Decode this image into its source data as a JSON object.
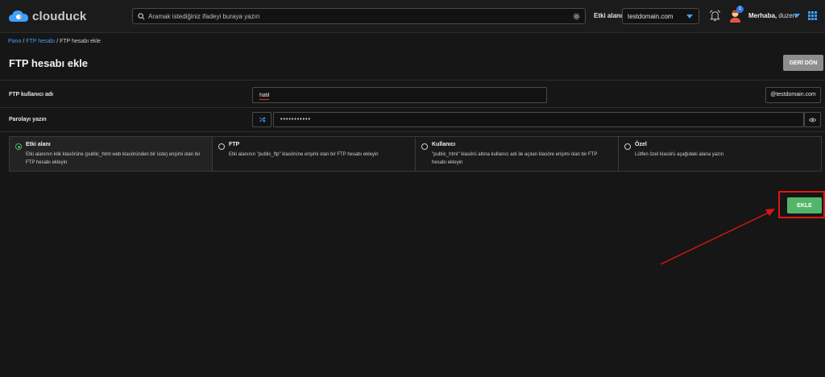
{
  "brand": {
    "name": "clouduck"
  },
  "search": {
    "placeholder": "Aramak istediğiniz ifadeyi buraya yazın"
  },
  "header": {
    "domain_label": "Etki alanı",
    "domain_value": "testdomain.com",
    "notification_count": "1",
    "greeting_prefix": "Merhaba,",
    "username": "duzen"
  },
  "breadcrumb": {
    "items": [
      "Pano",
      "FTP hesabı",
      "FTP hesabı ekle"
    ],
    "separator": " / "
  },
  "page": {
    "title": "FTP hesabı ekle",
    "back_label": "GERİ DÖN"
  },
  "form": {
    "username_label": "FTP kullanıcı adı",
    "username_value": "halil",
    "domain_suffix": "@testdomain.com",
    "password_label": "Parolayı yazın",
    "password_value": "•••••••••••"
  },
  "options": [
    {
      "title": "Etki alanı",
      "desc": "Etki alanının kök klasörüne (public_html web klasöründen bir üste) erişimi olan bir FTP hesabı ekleyin",
      "selected": true
    },
    {
      "title": "FTP",
      "desc": "Etki alanının \"public_ftp\" klasörüne erişimi olan bir FTP hesabı ekleyin",
      "selected": false
    },
    {
      "title": "Kullanıcı",
      "desc": "\"public_html\" klasörü altına kullanıcı adı ile açılan klasöre erişimi olan bir FTP hesabı ekleyin",
      "selected": false
    },
    {
      "title": "Özel",
      "desc": "Lütfen özel klasörü aşağıdaki alana yazın",
      "selected": false
    }
  ],
  "actions": {
    "add_label": "EKLE"
  },
  "colors": {
    "accent": "#3ea0ff",
    "success": "#53b56a",
    "annotation": "#e01515"
  }
}
